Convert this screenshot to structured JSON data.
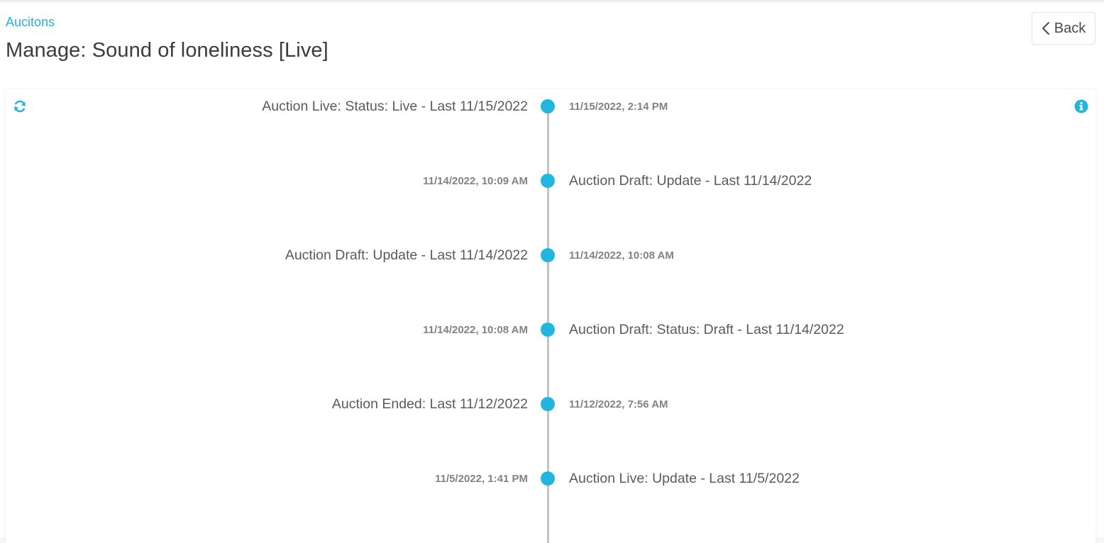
{
  "breadcrumb": {
    "label": "Aucitons"
  },
  "page": {
    "title": "Manage: Sound of loneliness [Live]"
  },
  "back_button": {
    "label": "Back"
  },
  "icons": {
    "refresh": "refresh-icon",
    "info": "info-icon",
    "back": "chevron-left-icon"
  },
  "colors": {
    "accent": "#29b2d6",
    "dot": "#20b6e0",
    "line": "#c3c3c3",
    "title_text": "#3b3b3b"
  },
  "timeline": {
    "events": [
      {
        "title": "Auction Live: Status: Live - Last 11/15/2022",
        "time": "11/15/2022, 2:14 PM"
      },
      {
        "title": "Auction Draft: Update - Last 11/14/2022",
        "time": "11/14/2022, 10:09 AM"
      },
      {
        "title": "Auction Draft: Update - Last 11/14/2022",
        "time": "11/14/2022, 10:08 AM"
      },
      {
        "title": "Auction Draft: Status: Draft - Last 11/14/2022",
        "time": "11/14/2022, 10:08 AM"
      },
      {
        "title": "Auction Ended: Last 11/12/2022",
        "time": "11/12/2022, 7:56 AM"
      },
      {
        "title": "Auction Live: Update - Last 11/5/2022",
        "time": "11/5/2022, 1:41 PM"
      }
    ]
  }
}
